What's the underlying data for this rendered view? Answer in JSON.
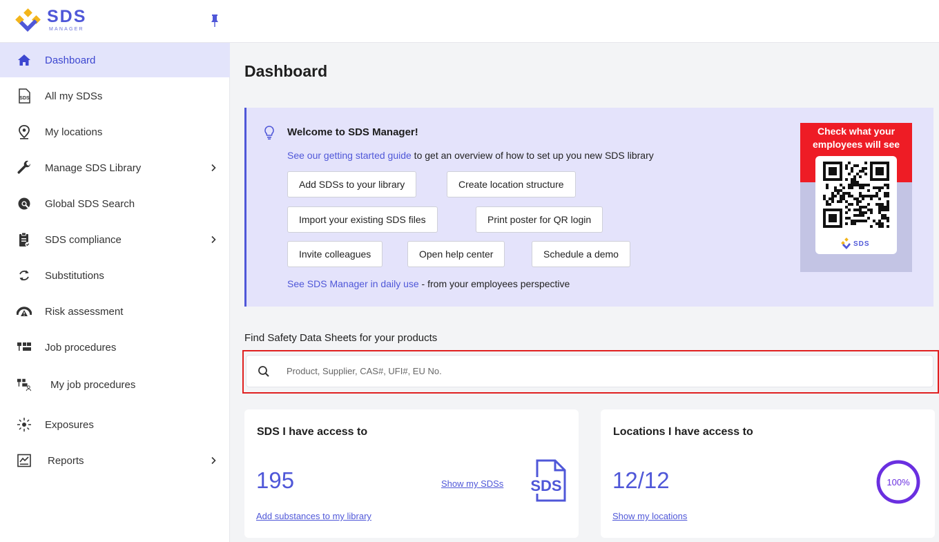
{
  "brand": {
    "name": "SDS",
    "sub": "MANAGER"
  },
  "sidebar": {
    "items": [
      {
        "label": "Dashboard",
        "icon": "home-icon",
        "active": true
      },
      {
        "label": "All my SDSs",
        "icon": "sds-doc-icon"
      },
      {
        "label": "My locations",
        "icon": "location-pin-icon"
      },
      {
        "label": "Manage SDS Library",
        "icon": "wrench-icon",
        "chevron": true
      },
      {
        "label": "Global SDS Search",
        "icon": "globe-search-icon"
      },
      {
        "label": "SDS compliance",
        "icon": "clipboard-icon",
        "chevron": true
      },
      {
        "label": "Substitutions",
        "icon": "refresh-icon"
      },
      {
        "label": "Risk assessment",
        "icon": "gauge-warning-icon"
      },
      {
        "label": "Job procedures",
        "icon": "hierarchy-icon"
      },
      {
        "label": "My job procedures",
        "icon": "user-hierarchy-icon"
      },
      {
        "label": "Exposures",
        "icon": "exposure-icon"
      },
      {
        "label": "Reports",
        "icon": "chart-report-icon",
        "chevron": true
      }
    ]
  },
  "main": {
    "title": "Dashboard",
    "welcome": {
      "title": "Welcome to SDS Manager!",
      "guide_link": "See our getting started guide",
      "guide_rest": " to get an overview of how to set up you new SDS library",
      "buttons": {
        "add_sds": "Add SDSs to your library",
        "create_location": "Create location structure",
        "import_sds": "Import your existing SDS files",
        "print_poster": "Print poster for QR login",
        "invite": "Invite colleagues",
        "help_center": "Open help center",
        "schedule_demo": "Schedule a demo"
      },
      "daily_link": "See SDS Manager in daily use",
      "daily_rest": " - from your employees perspective",
      "qr_promo": {
        "line1": "Check what your",
        "line2": "employees will see"
      }
    },
    "search": {
      "label": "Find Safety Data Sheets for your products",
      "placeholder": "Product, Supplier, CAS#, UFI#, EU No."
    },
    "cards": {
      "sds": {
        "title": "SDS I have access to",
        "count": "195",
        "show_link": "Show my SDSs",
        "add_link": "Add substances to my library",
        "icon_text": "SDS"
      },
      "locations": {
        "title": "Locations I have access to",
        "count": "12/12",
        "show_link": "Show my locations",
        "percent": "100%"
      }
    }
  },
  "colors": {
    "accent": "#4f57d8",
    "active_bg": "#e3e4fb",
    "welcome_bg": "#e4e3fb",
    "promo_red": "#ee1c25",
    "ring": "#6a2fe0"
  }
}
